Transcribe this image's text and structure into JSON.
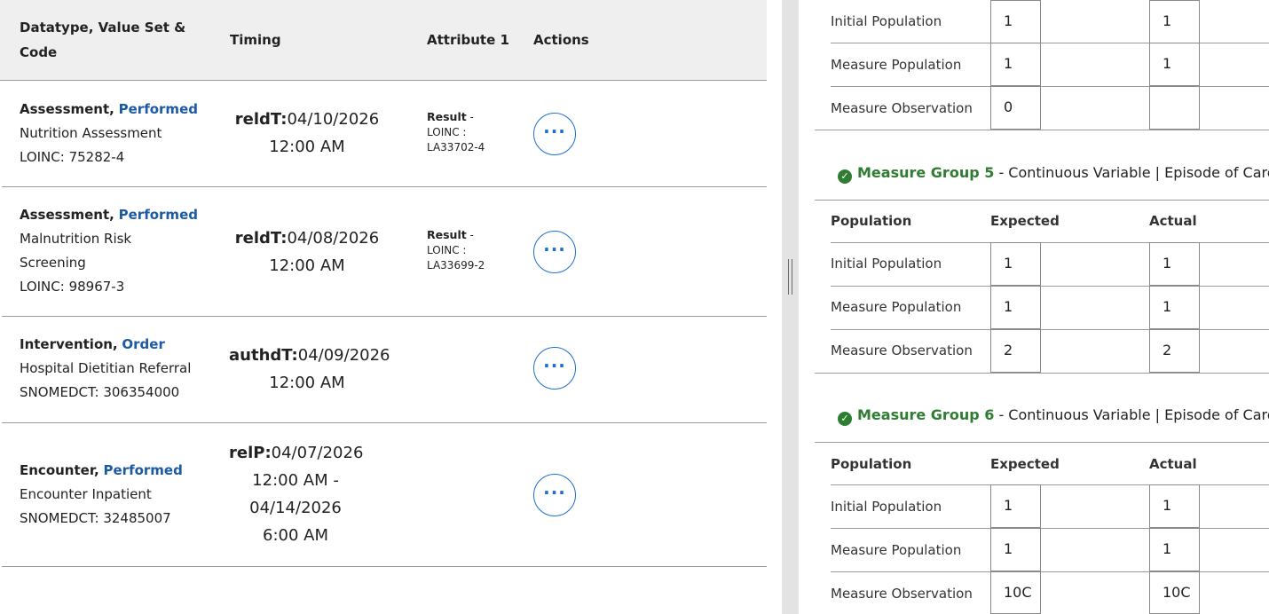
{
  "table": {
    "headers": {
      "datatype": "Datatype, Value Set & Code",
      "timing": "Timing",
      "attribute": "Attribute 1",
      "actions": "Actions"
    },
    "rows": [
      {
        "category": "Assessment,",
        "action": "Performed",
        "line2": "Nutrition Assessment",
        "line3": "LOINC: 75282-4",
        "line4": "",
        "timing_label": "reldT:",
        "timing_lines": [
          "04/10/2026",
          "12:00 AM"
        ],
        "attr_label": "Result",
        "attr_sep": " -",
        "attr_lines": [
          "LOINC :",
          "LA33702-4"
        ],
        "actions_icon": "ellipsis-icon",
        "actions_glyph": "···"
      },
      {
        "category": "Assessment,",
        "action": "Performed",
        "line2": "Malnutrition Risk",
        "line3": "Screening",
        "line4": "LOINC: 98967-3",
        "timing_label": "reldT:",
        "timing_lines": [
          "04/08/2026",
          "12:00 AM"
        ],
        "attr_label": "Result",
        "attr_sep": " -",
        "attr_lines": [
          "LOINC :",
          "LA33699-2"
        ],
        "actions_icon": "ellipsis-icon",
        "actions_glyph": "···"
      },
      {
        "category": "Intervention,",
        "action": "Order",
        "line2": "Hospital Dietitian Referral",
        "line3": "SNOMEDCT: 306354000",
        "line4": "",
        "timing_label": "authdT:",
        "timing_lines": [
          "04/09/2026",
          "12:00 AM"
        ],
        "attr_label": "",
        "attr_sep": "",
        "attr_lines": [
          "",
          ""
        ],
        "actions_icon": "ellipsis-icon",
        "actions_glyph": "···"
      },
      {
        "category": "Encounter,",
        "action": "Performed",
        "line2": "Encounter Inpatient",
        "line3": "SNOMEDCT: 32485007",
        "line4": "",
        "timing_label": "relP:",
        "timing_lines": [
          "04/07/2026",
          "12:00 AM -",
          "04/14/2026",
          "6:00 AM"
        ],
        "attr_label": "",
        "attr_sep": "",
        "attr_lines": [
          "",
          ""
        ],
        "actions_icon": "ellipsis-icon",
        "actions_glyph": "···"
      }
    ]
  },
  "groups": {
    "top": {
      "rows": [
        {
          "label": "Initial Population",
          "expected": "1",
          "actual": "1"
        },
        {
          "label": "Measure Population",
          "expected": "1",
          "actual": "1"
        },
        {
          "label": "Measure Observation",
          "expected": "0",
          "actual": ""
        }
      ]
    },
    "g5": {
      "status_icon": "check-circle-icon",
      "name": "Measure Group 5",
      "desc": " - Continuous Variable | Episode of Care",
      "headers": {
        "population": "Population",
        "expected": "Expected",
        "actual": "Actual"
      },
      "rows": [
        {
          "label": "Initial Population",
          "expected": "1",
          "actual": "1"
        },
        {
          "label": "Measure Population",
          "expected": "1",
          "actual": "1"
        },
        {
          "label": "Measure Observation",
          "expected": "2",
          "actual": "2"
        }
      ]
    },
    "g6": {
      "status_icon": "check-circle-icon",
      "name": "Measure Group 6",
      "desc": " - Continuous Variable | Episode of Care",
      "headers": {
        "population": "Population",
        "expected": "Expected",
        "actual": "Actual"
      },
      "rows": [
        {
          "label": "Initial Population",
          "expected": "1",
          "actual": "1"
        },
        {
          "label": "Measure Population",
          "expected": "1",
          "actual": "1"
        },
        {
          "label": "Measure Observation",
          "expected": "10C",
          "actual": "10C"
        }
      ]
    }
  },
  "colors": {
    "link": "#1c5aa6",
    "action_btn": "#1c6fd1",
    "success": "#2e7d32",
    "header_bg": "#efefef"
  }
}
